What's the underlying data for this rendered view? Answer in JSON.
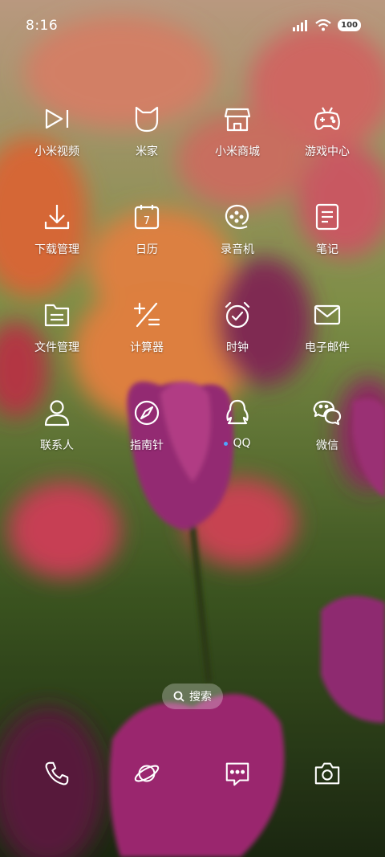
{
  "status_bar": {
    "time": "8:16",
    "battery": "100",
    "icons": [
      "signal-icon",
      "wifi-icon",
      "battery-icon"
    ]
  },
  "apps": [
    {
      "label": "小米视频",
      "icon": "video-play-icon"
    },
    {
      "label": "米家",
      "icon": "mijia-icon"
    },
    {
      "label": "小米商城",
      "icon": "store-icon"
    },
    {
      "label": "游戏中心",
      "icon": "gamepad-icon"
    },
    {
      "label": "下载管理",
      "icon": "download-icon"
    },
    {
      "label": "日历",
      "icon": "calendar-icon",
      "day": "7"
    },
    {
      "label": "录音机",
      "icon": "recorder-icon"
    },
    {
      "label": "笔记",
      "icon": "notes-icon"
    },
    {
      "label": "文件管理",
      "icon": "folder-icon"
    },
    {
      "label": "计算器",
      "icon": "calculator-icon"
    },
    {
      "label": "时钟",
      "icon": "alarm-clock-icon"
    },
    {
      "label": "电子邮件",
      "icon": "mail-icon"
    },
    {
      "label": "联系人",
      "icon": "contacts-icon"
    },
    {
      "label": "指南针",
      "icon": "compass-icon"
    },
    {
      "label": "QQ",
      "icon": "qq-penguin-icon",
      "has_notification_dot": true
    },
    {
      "label": "微信",
      "icon": "wechat-icon"
    }
  ],
  "search": {
    "label": "搜索",
    "icon": "search-icon"
  },
  "dock": [
    {
      "icon": "phone-icon"
    },
    {
      "icon": "browser-planet-icon"
    },
    {
      "icon": "messages-icon"
    },
    {
      "icon": "camera-icon"
    }
  ],
  "colors": {
    "accent_dot": "#4ea6ff",
    "icon_stroke": "#ffffff"
  }
}
